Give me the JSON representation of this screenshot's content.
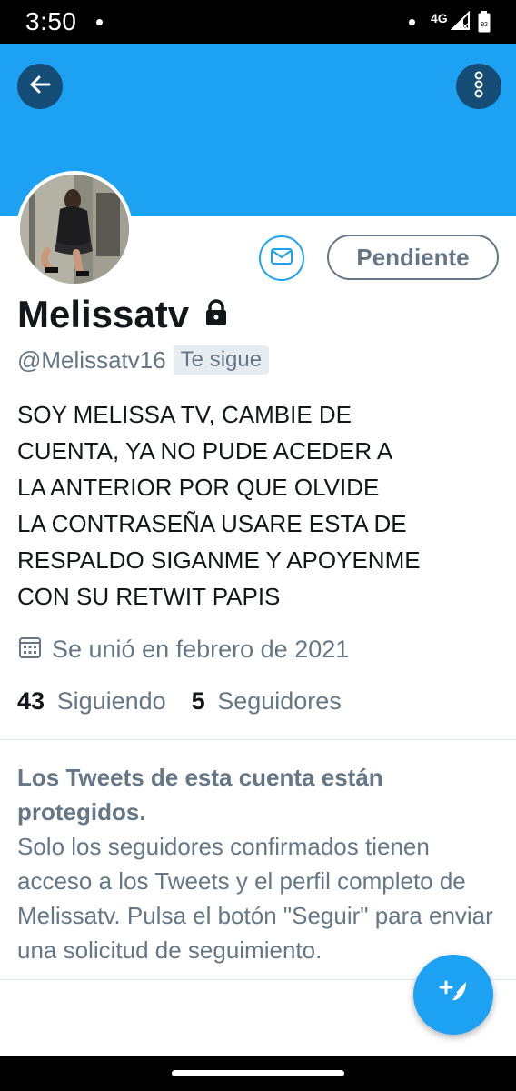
{
  "status_bar": {
    "time": "3:50",
    "network": "4G",
    "battery_level": "92"
  },
  "profile": {
    "display_name": "Melissatv",
    "handle": "@Melissatv16",
    "follows_you_badge": "Te sigue",
    "bio": "SOY MELISSA TV, CAMBIE DE\nCUENTA, YA NO PUDE ACEDER A\nLA ANTERIOR POR QUE OLVIDE\nLA CONTRASEÑA USARE ESTA DE\nRESPALDO   SIGANME Y APOYENME\nCON SU RETWIT PAPIS",
    "joined": "Se unió en febrero de 2021",
    "following_count": "43",
    "following_label": "Siguiendo",
    "followers_count": "5",
    "followers_label": "Seguidores"
  },
  "actions": {
    "pending_label": "Pendiente"
  },
  "protected_notice": {
    "title": "Los Tweets de esta cuenta están protegidos.",
    "body": "Solo los seguidores confirmados tienen acceso a los Tweets y el perfil completo de Melissatv. Pulsa el botón \"Seguir\" para enviar una solicitud de seguimiento."
  },
  "colors": {
    "accent": "#1da1f2",
    "secondary_text": "#657786",
    "primary_text": "#14171a"
  },
  "icons": {
    "back": "arrow-left-icon",
    "more": "vertical-dots-icon",
    "message": "envelope-icon",
    "lock": "lock-icon",
    "calendar": "calendar-icon",
    "compose": "feather-plus-icon"
  }
}
